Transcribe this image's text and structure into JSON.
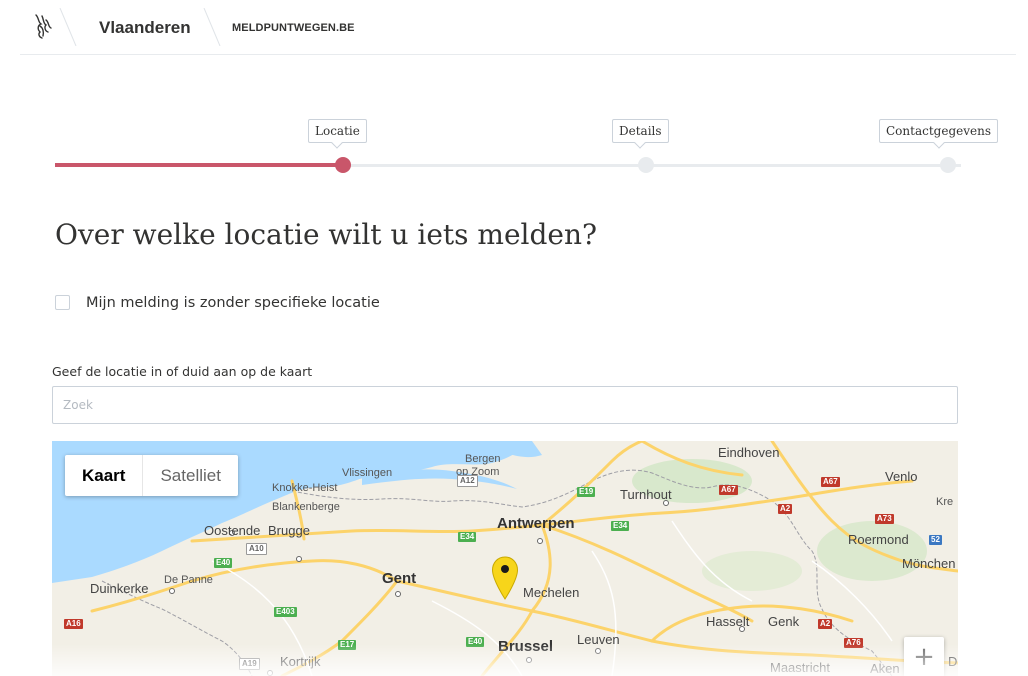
{
  "header": {
    "brand": "Vlaanderen",
    "site_link": "MELDPUNTWEGEN.BE"
  },
  "stepper": {
    "steps": [
      {
        "label": "Locatie",
        "state": "active"
      },
      {
        "label": "Details",
        "state": "upcoming"
      },
      {
        "label": "Contactgegevens",
        "state": "upcoming"
      }
    ]
  },
  "main": {
    "title": "Over welke locatie wilt u iets melden?",
    "no_location_checkbox": {
      "label": "Mijn melding is zonder specifieke locatie",
      "checked": false
    },
    "location_field": {
      "label": "Geef de locatie in of duid aan op de kaart",
      "placeholder": "Zoek",
      "value": ""
    }
  },
  "map": {
    "type_control": {
      "map_label": "Kaart",
      "satellite_label": "Satelliet",
      "selected": "Kaart"
    },
    "places": {
      "eindhoven": "Eindhoven",
      "vlissingen": "Vlissingen",
      "bergen_op_zoom_1": "Bergen",
      "bergen_op_zoom_2": "op Zoom",
      "venlo": "Venlo",
      "kre": "Kre",
      "knokke": "Knokke-Heist",
      "blankenberge": "Blankenberge",
      "turnhout": "Turnhout",
      "oostende": "Oostende",
      "brugge": "Brugge",
      "antwerpen": "Antwerpen",
      "roermond": "Roermond",
      "monchen": "Mönchen",
      "duinkerke": "Duinkerke",
      "de_panne": "De Panne",
      "gent": "Gent",
      "mechelen": "Mechelen",
      "hasselt": "Hasselt",
      "genk": "Genk",
      "brussel": "Brussel",
      "leuven": "Leuven",
      "kortrijk": "Kortrijk",
      "maastricht": "Maastricht",
      "aken": "Aken",
      "d": "D"
    },
    "roads": {
      "a12": "A12",
      "e19": "E19",
      "a67": "A67",
      "a2": "A2",
      "a73": "A73",
      "e34_1": "E34",
      "e34_2": "E34",
      "a10": "A10",
      "e40_1": "E40",
      "e40_2": "E40",
      "a16": "A16",
      "e403": "E403",
      "e17": "E17",
      "a19": "A19",
      "a76": "A76",
      "n52": "52"
    },
    "zoom_in_label": "+",
    "colors": {
      "water": "#aadaff",
      "land": "#f2efe6",
      "highway": "#fcd36a",
      "pin": "#f7d51a"
    }
  },
  "colors": {
    "accent": "#c9566a",
    "track": "#e8ebee",
    "border": "#cbd2da"
  }
}
